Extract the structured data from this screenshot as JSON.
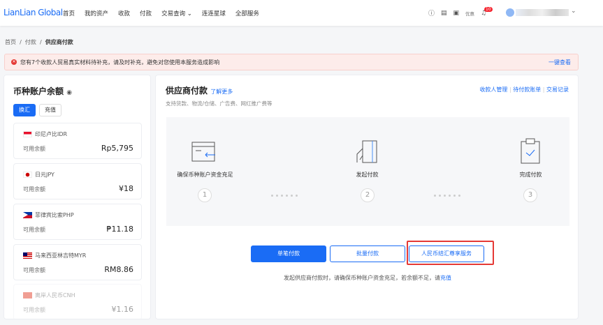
{
  "header": {
    "logo": "LianLian Global",
    "nav": [
      "首页",
      "我的资产",
      "收款",
      "付款",
      "交易查询",
      "连连星球",
      "全部服务"
    ],
    "promo": "优惠",
    "notif_count": "10"
  },
  "breadcrumb": [
    "首页",
    "付款",
    "供应商付款"
  ],
  "alert": {
    "text": "您有7个收款人贸易真实材料待补充，请及时补充，避免对您使用本服务造成影响",
    "action": "一键查看"
  },
  "balances": {
    "title": "币种账户余额",
    "exchange": "换汇",
    "topup": "充值",
    "label": "可用余额",
    "items": [
      {
        "name": "印尼卢比IDR",
        "amount": "Rp5,795"
      },
      {
        "name": "日元JPY",
        "amount": "¥18"
      },
      {
        "name": "菲律宾比索PHP",
        "amount": "₱11.18"
      },
      {
        "name": "马来西亚林吉特MYR",
        "amount": "RM8.86"
      },
      {
        "name": "离岸人民币CNH",
        "amount": "¥1.16"
      }
    ]
  },
  "main": {
    "title": "供应商付款",
    "learn_more": "了解更多",
    "subtitle": "支持货款、物流/仓储、广告费、网红推广费等",
    "links": [
      "收款人管理",
      "待付款账单",
      "交易记录"
    ],
    "steps": [
      {
        "label": "确保币种账户资金充足",
        "num": "1"
      },
      {
        "label": "发起付款",
        "num": "2"
      },
      {
        "label": "完成付款",
        "num": "3"
      }
    ],
    "buttons": {
      "single": "单笔付款",
      "batch": "批量付款",
      "rmb": "人民币结汇尊享服务"
    },
    "footer": "发起供应商付款时，请确保币种账户资金充足，若余额不足，请",
    "footer_link": "充值"
  },
  "colors": {
    "primary": "#1a6cf5",
    "alert_bg": "#fdecea",
    "highlight": "#e53935"
  }
}
